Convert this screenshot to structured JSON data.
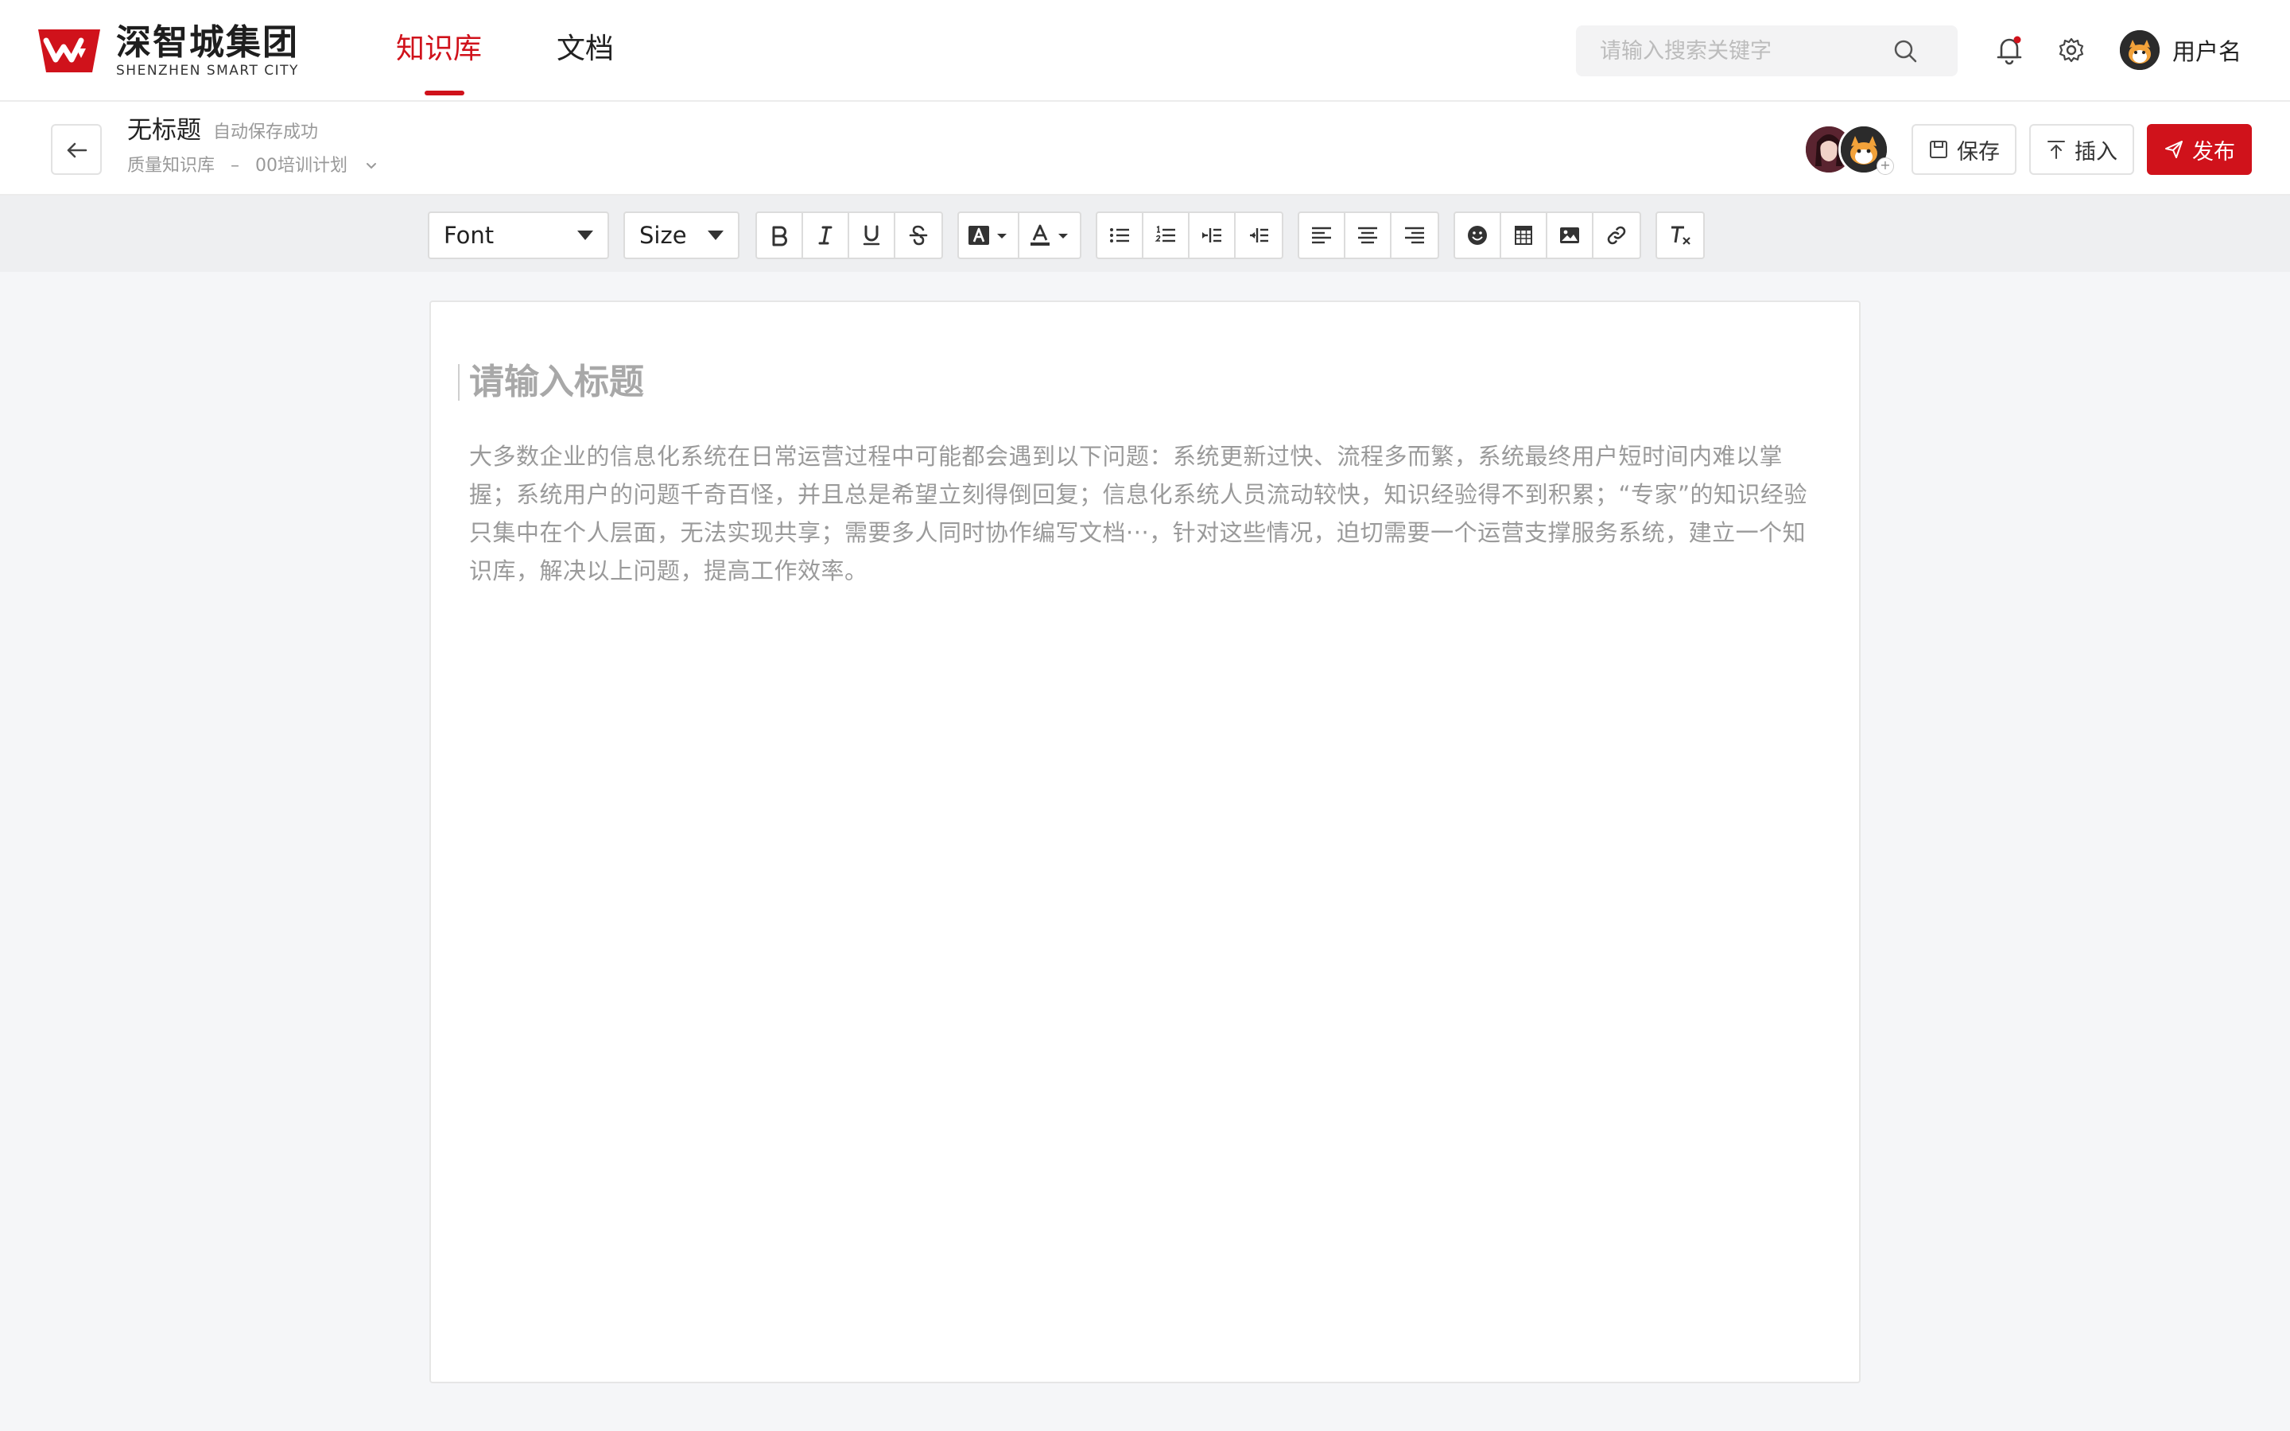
{
  "brand": {
    "name_cn": "深智城集团",
    "name_en": "SHENZHEN SMART CITY",
    "color": "#d0121b"
  },
  "nav": {
    "tabs": [
      {
        "label": "知识库",
        "active": true
      },
      {
        "label": "文档",
        "active": false
      }
    ]
  },
  "search": {
    "placeholder": "请输入搜索关键字",
    "value": ""
  },
  "header_icons": [
    "bell-icon",
    "gear-icon"
  ],
  "notification_dot": true,
  "user": {
    "name": "用户名"
  },
  "doc": {
    "title": "无标题",
    "autosave": "自动保存成功",
    "breadcrumb": [
      "质量知识库",
      "00培训计划"
    ],
    "breadcrumb_sep": "–"
  },
  "actions": {
    "save": "保存",
    "insert": "插入",
    "publish": "发布"
  },
  "toolbar": {
    "font_label": "Font",
    "size_label": "Size",
    "groups": [
      [
        "bold-icon",
        "italic-icon",
        "underline-icon",
        "strikethrough-icon"
      ],
      [
        "background-color-icon",
        "font-color-icon"
      ],
      [
        "bullet-list-icon",
        "numbered-list-icon",
        "indent-icon",
        "outdent-icon"
      ],
      [
        "align-left-icon",
        "align-center-icon",
        "align-right-icon"
      ],
      [
        "emoji-icon",
        "table-icon",
        "image-icon",
        "link-icon"
      ],
      [
        "clear-format-icon"
      ]
    ]
  },
  "editor": {
    "title_placeholder": "请输入标题",
    "body_placeholder": "大多数企业的信息化系统在日常运营过程中可能都会遇到以下问题：系统更新过快、流程多而繁，系统最终用户短时间内难以掌握；系统用户的问题千奇百怪，并且总是希望立刻得倒回复；信息化系统人员流动较快，知识经验得不到积累；“专家”的知识经验只集中在个人层面，无法实现共享；需要多人同时协作编写文档···，针对这些情况，迫切需要一个运营支撑服务系统，建立一个知识库，解决以上问题，提高工作效率。"
  }
}
